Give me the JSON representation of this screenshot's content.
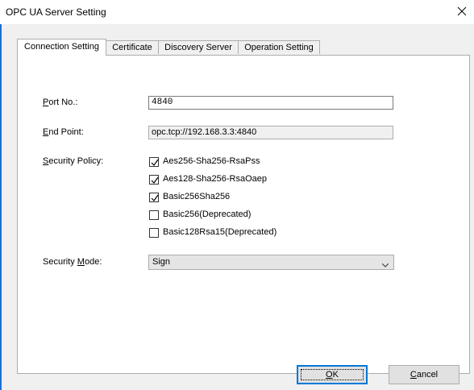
{
  "window": {
    "title": "OPC UA Server Setting"
  },
  "tabs": [
    {
      "label": "Connection Setting",
      "active": true
    },
    {
      "label": "Certificate",
      "active": false
    },
    {
      "label": "Discovery Server",
      "active": false
    },
    {
      "label": "Operation Setting",
      "active": false
    }
  ],
  "connection": {
    "port_label_prefix": "P",
    "port_label_rest": "ort No.:",
    "port_value": "4840",
    "endpoint_label_prefix": "E",
    "endpoint_label_rest": "nd Point:",
    "endpoint_value": "opc.tcp://192.168.3.3:4840",
    "policy_label_prefix": "S",
    "policy_label_rest": "ecurity Policy:",
    "policies": [
      {
        "label": "Aes256-Sha256-RsaPss",
        "checked": true
      },
      {
        "label": "Aes128-Sha256-RsaOaep",
        "checked": true
      },
      {
        "label": "Basic256Sha256",
        "checked": true
      },
      {
        "label": "Basic256(Deprecated)",
        "checked": false
      },
      {
        "label": "Basic128Rsa15(Deprecated)",
        "checked": false
      }
    ],
    "mode_label_before": "Security ",
    "mode_label_underlined": "M",
    "mode_label_after": "ode:",
    "mode_value": "Sign"
  },
  "buttons": {
    "ok_underlined": "O",
    "ok_rest": "K",
    "cancel_underlined": "C",
    "cancel_rest": "ancel"
  },
  "colors": {
    "accent": "#0078d7",
    "window_border": "#1e6fd9"
  },
  "icons": {
    "close": "close-icon",
    "dropdown": "chevron-down-icon",
    "check": "checkmark-icon"
  }
}
